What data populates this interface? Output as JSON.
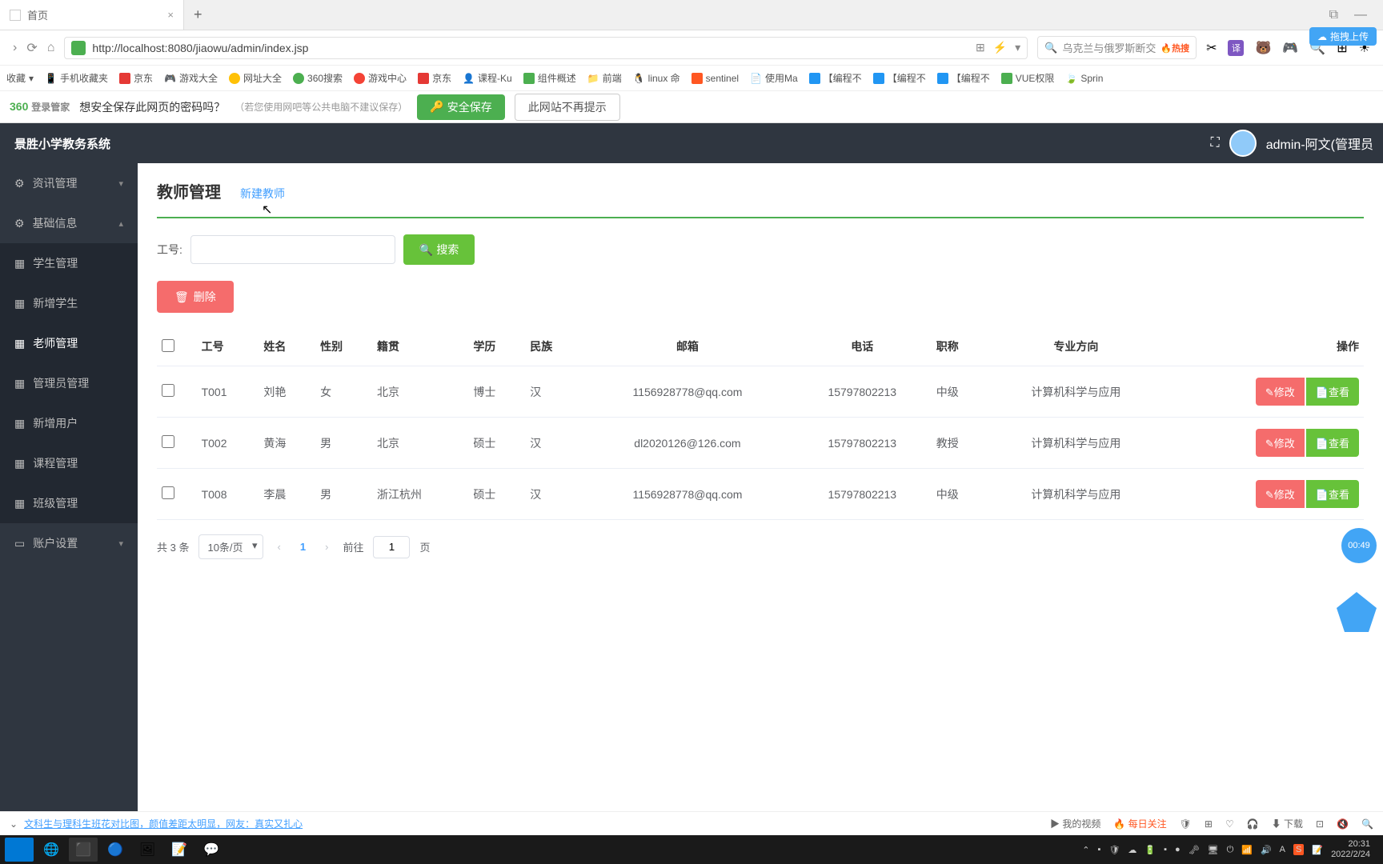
{
  "browser": {
    "tab_title": "首页",
    "url_display": "http://localhost:8080/jiaowu/admin/index.jsp",
    "search_placeholder": "乌克兰与俄罗斯断交",
    "hot_label": "热搜",
    "upload_label": "拖拽上传",
    "bookmarks": [
      "收藏",
      "手机收藏夹",
      "京东",
      "游戏大全",
      "网址大全",
      "360搜索",
      "游戏中心",
      "京东",
      "课程-Ku",
      "组件概述",
      "前端",
      "linux 命",
      "sentinel",
      "使用Ma",
      "【编程不",
      "【编程不",
      "【编程不",
      "VUE权限",
      "Sprin"
    ]
  },
  "password_bar": {
    "brand": "360 登录管家",
    "question": "想安全保存此网页的密码吗？",
    "hint": "（若您使用网吧等公共电脑不建议保存）",
    "save": "安全保存",
    "dismiss": "此网站不再提示"
  },
  "app": {
    "title": "景胜小学教务系统",
    "user_label": "admin-阿文(管理员",
    "menu": {
      "info": "资讯管理",
      "base": "基础信息",
      "student": "学生管理",
      "add_student": "新增学生",
      "teacher": "老师管理",
      "admin": "管理员管理",
      "add_user": "新增用户",
      "course": "课程管理",
      "class": "班级管理",
      "account": "账户设置"
    }
  },
  "page": {
    "title": "教师管理",
    "add_link": "新建教师",
    "search_label": "工号:",
    "search_btn": "搜索",
    "delete_btn": "删除",
    "columns": [
      "工号",
      "姓名",
      "性别",
      "籍贯",
      "学历",
      "民族",
      "邮箱",
      "电话",
      "职称",
      "专业方向",
      "操作"
    ],
    "edit_label": "修改",
    "view_label": "查看",
    "rows": [
      {
        "id": "T001",
        "name": "刘艳",
        "gender": "女",
        "origin": "北京",
        "edu": "博士",
        "ethnic": "汉",
        "email": "1156928778@qq.com",
        "phone": "15797802213",
        "title": "中级",
        "major": "计算机科学与应用"
      },
      {
        "id": "T002",
        "name": "黄海",
        "gender": "男",
        "origin": "北京",
        "edu": "硕士",
        "ethnic": "汉",
        "email": "dl2020126@126.com",
        "phone": "15797802213",
        "title": "教授",
        "major": "计算机科学与应用"
      },
      {
        "id": "T008",
        "name": "李晨",
        "gender": "男",
        "origin": "浙江杭州",
        "edu": "硕士",
        "ethnic": "汉",
        "email": "1156928778@qq.com",
        "phone": "15797802213",
        "title": "中级",
        "major": "计算机科学与应用"
      }
    ]
  },
  "pagination": {
    "total": "共 3 条",
    "page_size": "10条/页",
    "current": "1",
    "goto_prefix": "前往",
    "goto_suffix": "页",
    "goto_value": "1"
  },
  "float": {
    "timer": "00:49"
  },
  "news": {
    "headline": "文科生与理科生班花对比图，颜值差距太明显，网友：真实又扎心",
    "my_video": "我的视频",
    "daily": "每日关注",
    "download": "下载"
  },
  "clock": {
    "time": "20:31",
    "date": "2022/2/24"
  }
}
